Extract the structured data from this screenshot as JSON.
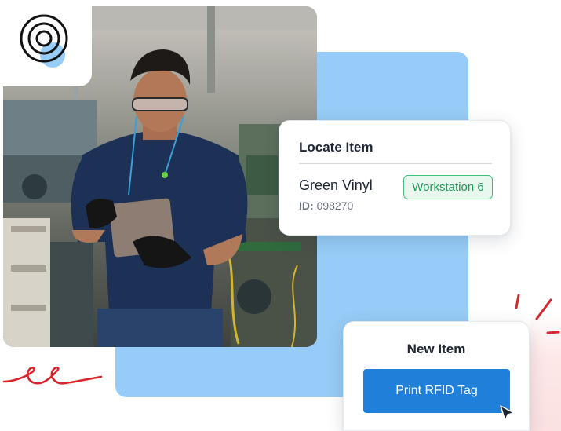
{
  "colors": {
    "accent_blue": "#1f7fd9",
    "panel_blue": "#96ccf7",
    "badge_green": "#1f9a57",
    "squiggle_red": "#d9242d"
  },
  "icons": {
    "logo": "concentric-rings-logo-icon",
    "cursor": "mouse-pointer-icon",
    "squiggle": "red-squiggle-icon",
    "sparks": "red-sparkle-lines-icon"
  },
  "locate_card": {
    "title": "Locate Item",
    "item_name": "Green Vinyl",
    "id_label": "ID:",
    "id_value": "098270",
    "location_badge": "Workstation 6"
  },
  "new_item_card": {
    "title": "New Item",
    "button_label": "Print RFID Tag"
  }
}
